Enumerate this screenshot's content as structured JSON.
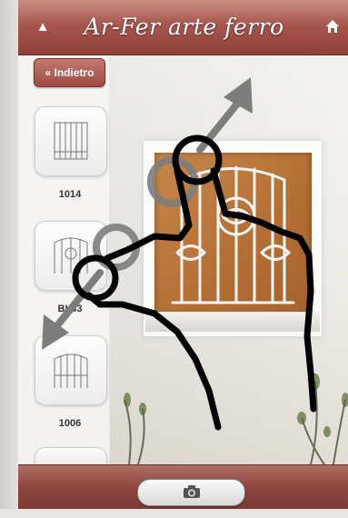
{
  "header": {
    "title": "Ar-Fer arte ferro",
    "up_icon": "triangle-up-icon",
    "home_icon": "home-icon"
  },
  "sidebar": {
    "back_label": "« Indietro",
    "items": [
      {
        "label": "1014"
      },
      {
        "label": "BL33"
      },
      {
        "label": "1006"
      }
    ]
  },
  "toolbar": {
    "camera_icon": "camera-icon"
  },
  "colors": {
    "accent": "#9e4a41",
    "gesture": "#000000",
    "arrow": "#7a7a7a"
  }
}
